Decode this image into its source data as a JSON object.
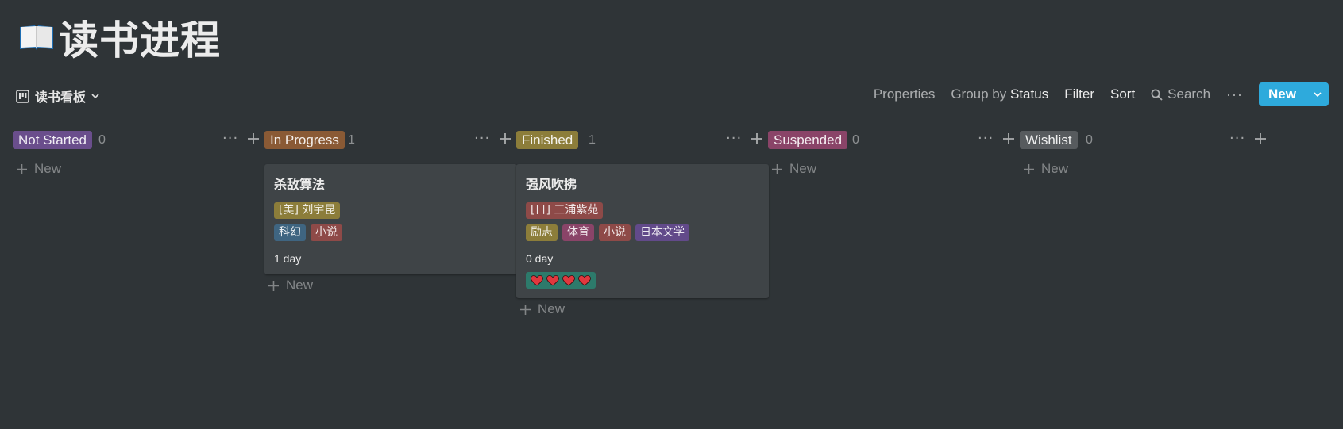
{
  "page": {
    "title": "读书进程",
    "icon": "open-book-icon"
  },
  "toolbar": {
    "view_label": "读书看板",
    "properties": "Properties",
    "group_by_prefix": "Group by",
    "group_by_value": "Status",
    "filter": "Filter",
    "sort": "Sort",
    "search": "Search",
    "more": "···",
    "new_label": "New"
  },
  "colors": {
    "background": "#2f3437",
    "card": "#3f4447",
    "accent": "#2eaadc"
  },
  "columns": [
    {
      "status": "Not Started",
      "count": "0",
      "color": "#6a4e8c",
      "new_label": "New",
      "cards": []
    },
    {
      "status": "In Progress",
      "count": "1",
      "color": "#8a5a35",
      "new_label": "New",
      "cards": [
        {
          "title": "杀敌算法",
          "author": "[美] 刘宇昆",
          "author_color": "#8c7d3a",
          "tags": [
            {
              "label": "科幻",
              "color": "#3f6581"
            },
            {
              "label": "小说",
              "color": "#8e4a48"
            }
          ],
          "duration": "1 day"
        }
      ]
    },
    {
      "status": "Finished",
      "count": "1",
      "color": "#8c7d3a",
      "new_label": "New",
      "cards": [
        {
          "title": "强风吹拂",
          "author": "[日] 三浦紫苑",
          "author_color": "#8e4a48",
          "tags": [
            {
              "label": "励志",
              "color": "#8c7d3a"
            },
            {
              "label": "体育",
              "color": "#8a4468"
            },
            {
              "label": "小说",
              "color": "#8e4a48"
            },
            {
              "label": "日本文学",
              "color": "#624a8a"
            }
          ],
          "duration": "0 day",
          "rating": 4,
          "rating_icon": "heart-icon",
          "rating_color": "#2d7a6b"
        }
      ]
    },
    {
      "status": "Suspended",
      "count": "0",
      "color": "#8a4468",
      "new_label": "New",
      "cards": []
    },
    {
      "status": "Wishlist",
      "count": "0",
      "color": "#575b5e",
      "new_label": "New",
      "cards": []
    }
  ]
}
